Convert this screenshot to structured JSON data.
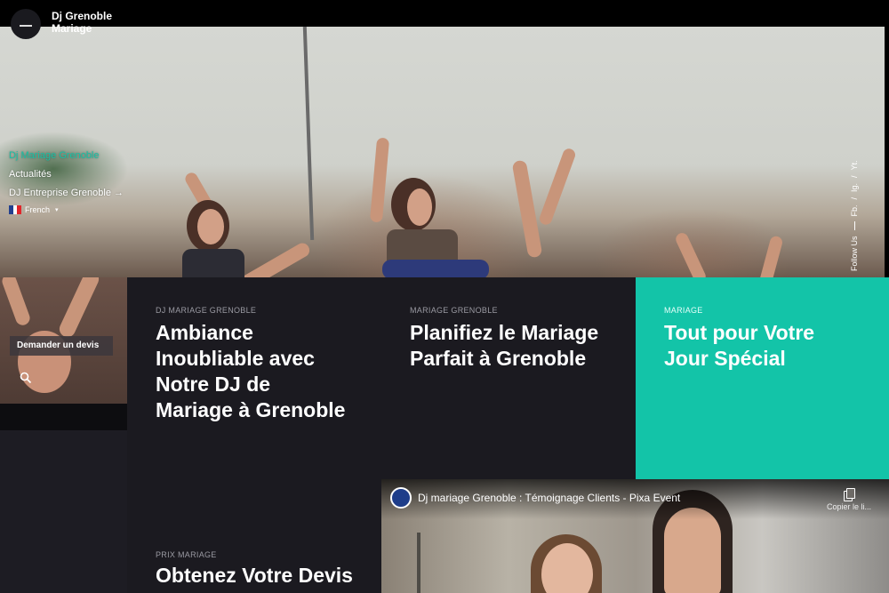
{
  "brand": {
    "line1": "Dj Grenoble",
    "line2": "Mariage"
  },
  "nav": {
    "items": [
      {
        "label": "Dj Mariage Grenoble",
        "active": true
      },
      {
        "label": "Actualités",
        "active": false
      },
      {
        "label": "DJ Entreprise Grenoble →",
        "active": false
      }
    ],
    "language": "French"
  },
  "cta": {
    "label": "Demander un devis"
  },
  "social": {
    "label": "Follow Us",
    "links": [
      "Fb.",
      "Ig.",
      "Yt."
    ]
  },
  "cards": [
    {
      "kicker": "DJ MARIAGE GRENOBLE",
      "title": "Ambiance Inoubliable avec Notre DJ de Mariage à Grenoble"
    },
    {
      "kicker": "MARIAGE GRENOBLE",
      "title": "Planifiez le Mariage Parfait à Grenoble"
    },
    {
      "kicker": "MARIAGE",
      "title": "Tout pour Votre Jour Spécial"
    },
    {
      "kicker": "PRIX MARIAGE",
      "title": "Obtenez Votre Devis"
    }
  ],
  "video": {
    "title": "Dj mariage Grenoble : Témoignage Clients - Pixa Event",
    "copy_label": "Copier le li..."
  },
  "colors": {
    "accent": "#13c4a8",
    "card_bg": "#1b1a20",
    "active_nav": "#16c2a6"
  },
  "icons": {
    "menu": "hamburger-icon",
    "search": "search-icon",
    "flag": "france-flag-icon",
    "copy": "copy-link-icon"
  }
}
